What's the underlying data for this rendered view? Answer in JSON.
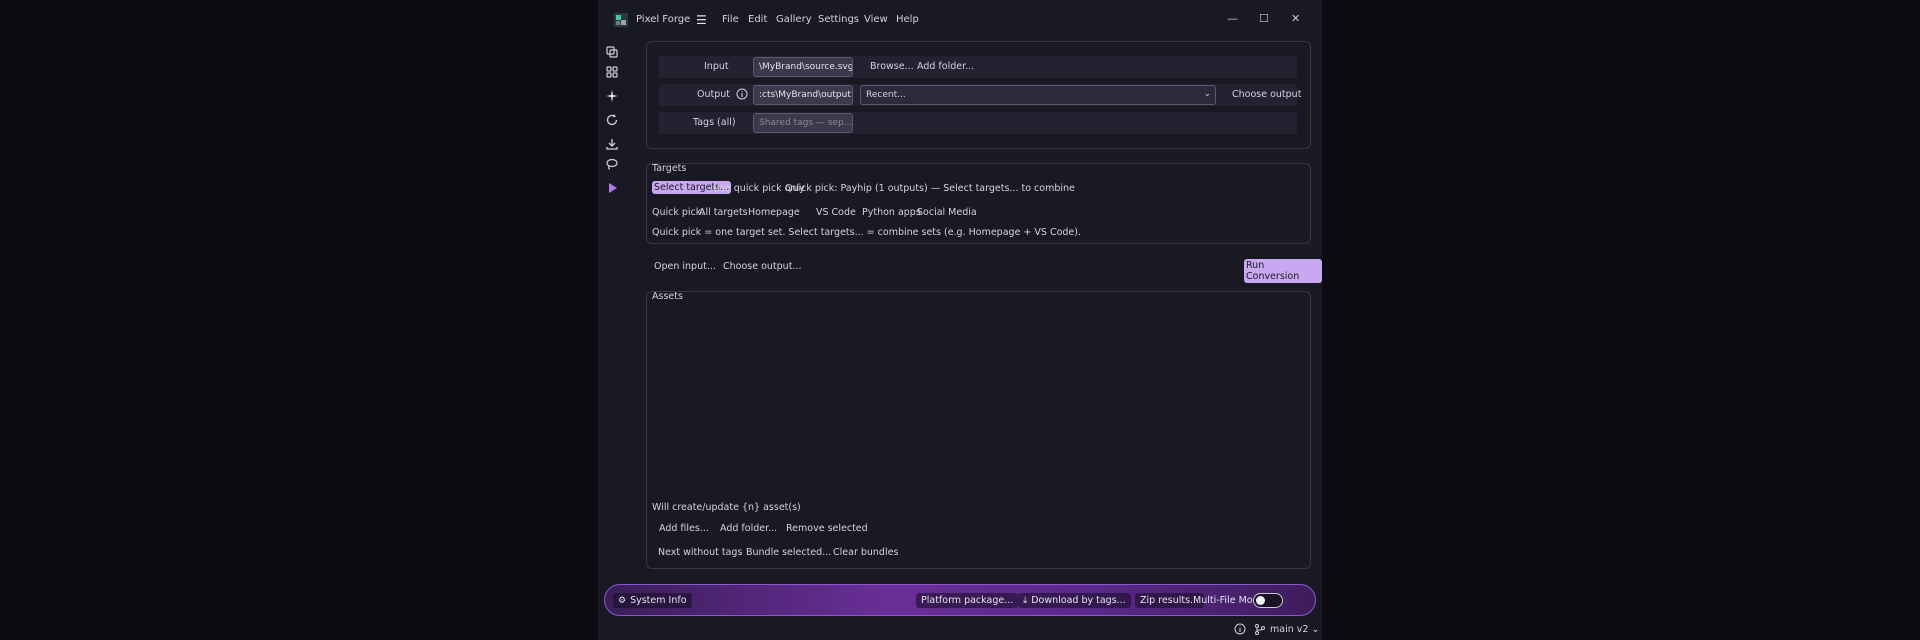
{
  "app": {
    "title": "Pixel Forge"
  },
  "menu": [
    "File",
    "Edit",
    "Gallery",
    "Settings",
    "View",
    "Help"
  ],
  "window_controls": {
    "minimize": "—",
    "maximize": "☐",
    "close": "✕"
  },
  "sidebar_icons": [
    "layers-icon",
    "grid-icon",
    "sparkle-icon",
    "refresh-icon",
    "download-icon",
    "lasso-icon",
    "play-icon"
  ],
  "io": {
    "input_label": "Input",
    "input_value": "\\MyBrand\\source.svg",
    "browse": "Browse...",
    "add_folder": "Add folder...",
    "output_label": "Output",
    "output_value": ":cts\\MyBrand\\output",
    "recent_value": "Recent...",
    "choose_output": "Choose output",
    "tags_label": "Tags (all)",
    "tags_placeholder": "Shared tags — sep..."
  },
  "targets": {
    "title": "Targets",
    "select_targets": "Select targets...",
    "use_quick_pick": "Use quick pick only",
    "quick_pick_status": "Quick pick: Payhip (1 outputs) — Select targets... to combine",
    "quick_pick_label": "Quick pick:",
    "quick_picks": [
      "All targets",
      "Homepage",
      "VS Code",
      "Python apps",
      "Social Media"
    ],
    "hint": "Quick pick = one target set. Select targets... = combine sets (e.g. Homepage + VS Code)."
  },
  "actions": {
    "open_input": "Open input...",
    "choose_output": "Choose output...",
    "run_conversion": "Run Conversion"
  },
  "assets": {
    "title": "Assets",
    "summary": "Will create/update {n} asset(s)",
    "add_files": "Add files...",
    "add_folder": "Add folder...",
    "remove_selected": "Remove selected",
    "next_without_tags": "Next without tags",
    "bundle_selected": "Bundle selected...",
    "clear_bundles": "Clear bundles"
  },
  "bottombar": {
    "system_info": "System Info",
    "platform_package": "Platform package...",
    "download_by_tags": "Download by tags...",
    "zip_results": "Zip results...",
    "multi_file_mode": "Multi-File Mode",
    "multi_file_mode_on": false
  },
  "status": {
    "branch": "main v2"
  },
  "colors": {
    "accent": "#c8a8f0",
    "bar_gradient_mid": "#6a2e98",
    "panel_border": "#36364a"
  }
}
